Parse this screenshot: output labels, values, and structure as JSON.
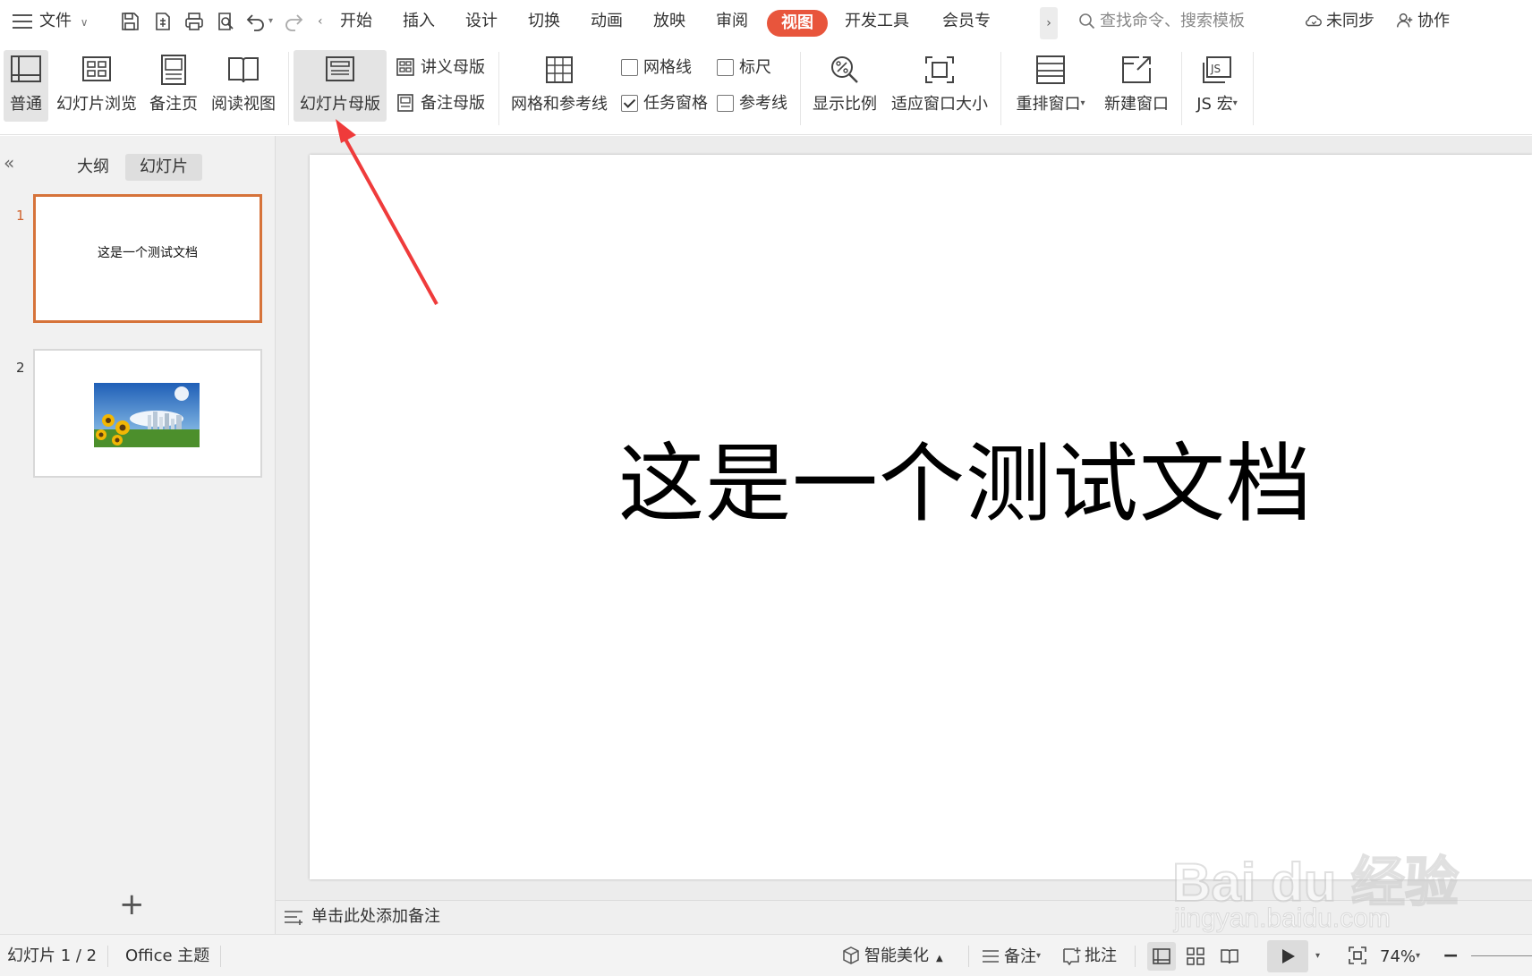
{
  "app": {
    "file_menu": "文件",
    "tabs": [
      {
        "label": "开始"
      },
      {
        "label": "插入"
      },
      {
        "label": "设计"
      },
      {
        "label": "切换"
      },
      {
        "label": "动画"
      },
      {
        "label": "放映"
      },
      {
        "label": "审阅"
      },
      {
        "label": "视图"
      },
      {
        "label": "开发工具"
      },
      {
        "label": "会员专"
      }
    ],
    "search_placeholder": "查找命令、搜索模板",
    "sync_status": "未同步",
    "collab": "协作",
    "accent_color": "#e8553c"
  },
  "ribbon": {
    "normal": "普通",
    "slide_sorter": "幻灯片浏览",
    "notes_page": "备注页",
    "reading_view": "阅读视图",
    "slide_master": "幻灯片母版",
    "handout_master": "讲义母版",
    "notes_master": "备注母版",
    "grid_guides": "网格和参考线",
    "gridlines": "网格线",
    "ruler": "标尺",
    "task_pane": "任务窗格",
    "guides": "参考线",
    "zoom": "显示比例",
    "fit_window": "适应窗口大小",
    "arrange_windows": "重排窗口",
    "new_window": "新建窗口",
    "js_macro": "JS 宏",
    "task_pane_checked": true,
    "gridlines_checked": false,
    "ruler_checked": false,
    "guides_checked": false
  },
  "panel": {
    "tab_outline": "大纲",
    "tab_slides": "幻灯片",
    "slides": [
      {
        "num": "1",
        "text": "这是一个测试文档"
      },
      {
        "num": "2",
        "text": ""
      }
    ],
    "add_slide": "+"
  },
  "slide": {
    "title": "这是一个测试文档"
  },
  "notes": {
    "placeholder": "单击此处添加备注"
  },
  "status": {
    "slide_counter": "幻灯片 1 / 2",
    "theme": "Office 主题",
    "beautify": "智能美化",
    "notes": "备注",
    "comments": "批注",
    "zoom": "74%"
  },
  "watermark": {
    "line1": "Bai du 经验",
    "line2": "jingyan.baidu.com"
  }
}
